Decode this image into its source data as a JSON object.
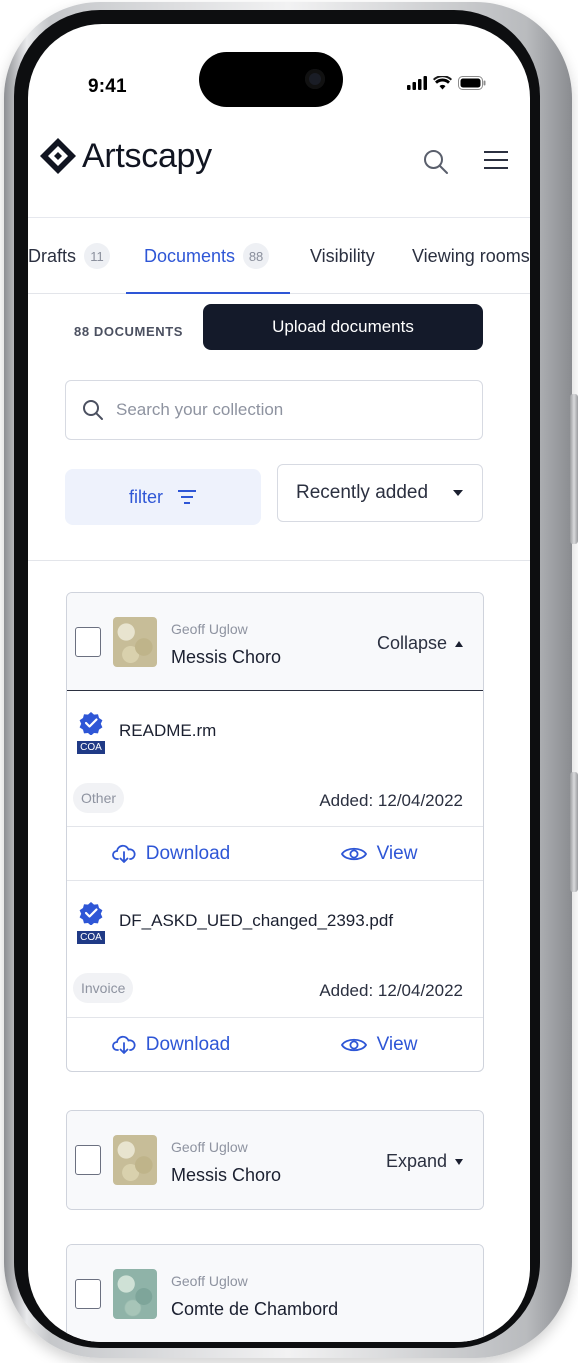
{
  "status_bar": {
    "time": "9:41"
  },
  "header": {
    "brand": "Artscapy"
  },
  "tabs": [
    {
      "label": "Drafts",
      "count": "11"
    },
    {
      "label": "Documents",
      "count": "88"
    },
    {
      "label": "Visibility",
      "count": ""
    },
    {
      "label": "Viewing rooms",
      "count": ""
    }
  ],
  "documents": {
    "count_label": "88 DOCUMENTS",
    "upload_label": "Upload documents",
    "search_placeholder": "Search your collection",
    "filter_label": "filter",
    "sort_value": "Recently added"
  },
  "artworks": [
    {
      "artist": "Geoff Uglow",
      "title": "Messis Choro",
      "toggle": "Collapse",
      "docs": [
        {
          "badge": "COA",
          "filename": "README.rm",
          "tag": "Other",
          "added": "Added: 12/04/2022",
          "download": "Download",
          "view": "View"
        },
        {
          "badge": "COA",
          "filename": "DF_ASKD_UED_changed_2393.pdf",
          "tag": "Invoice",
          "added": "Added: 12/04/2022",
          "download": "Download",
          "view": "View"
        }
      ]
    },
    {
      "artist": "Geoff Uglow",
      "title": "Messis Choro",
      "toggle": "Expand"
    },
    {
      "artist": "Geoff Uglow",
      "title": "Comte de Chambord"
    }
  ],
  "colors": {
    "accent": "#2e56d6",
    "dark": "#141a2a",
    "badge": "#203a86"
  }
}
